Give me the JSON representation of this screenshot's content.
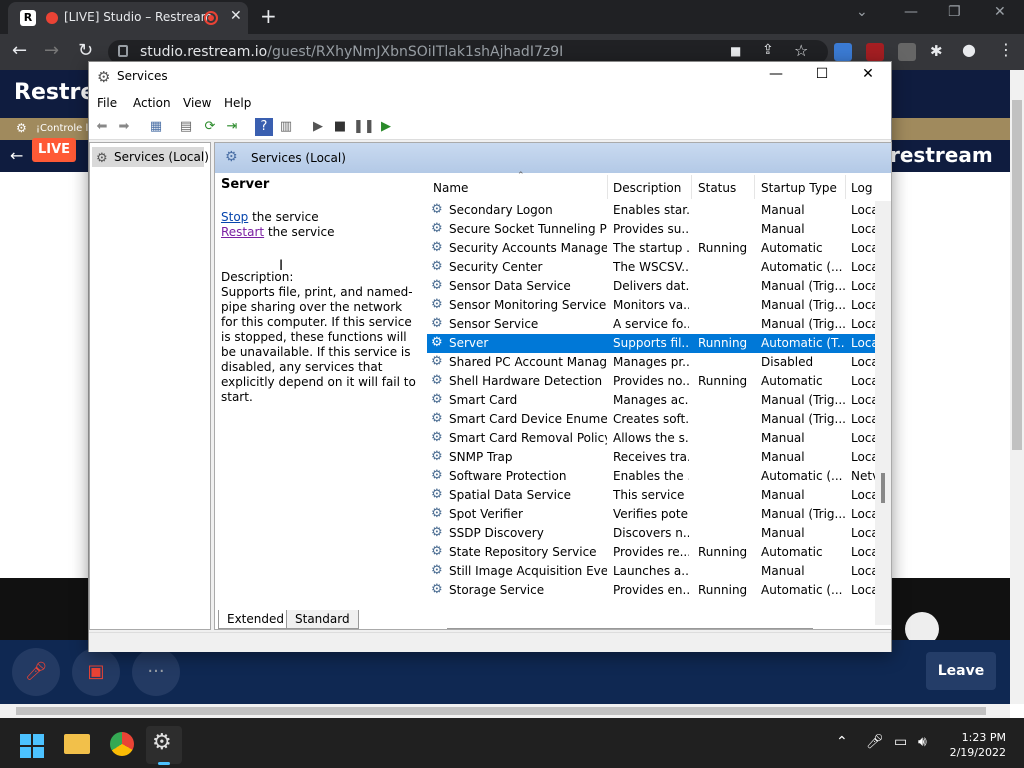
{
  "browser": {
    "tab_title": "[LIVE] Studio – Restream",
    "favicon_letter": "R",
    "url_host": "studio.restream.io",
    "url_path": "/guest/RXhyNmJXbnSOiITlak1shAjhadI7z9I",
    "new_tab": "+"
  },
  "page": {
    "logo": "Restrea",
    "live_badge": "LIVE",
    "banner": "¡Controle las",
    "logo_right": "restream",
    "leave_label": "Leave"
  },
  "services": {
    "title": "Services",
    "menu": [
      "File",
      "Action",
      "View",
      "Help"
    ],
    "tree_item": "Services (Local)",
    "pane_header": "Services (Local)",
    "selected": {
      "name": "Server",
      "stop_link": "Stop",
      "stop_rest": " the service",
      "restart_link": "Restart",
      "restart_rest": " the service",
      "desc_label": "Description:",
      "desc_text": "Supports file, print, and named-pipe sharing over the network for this computer. If this service is stopped, these functions will be unavailable. If this service is disabled, any services that explicitly depend on it will fail to start."
    },
    "columns": [
      "Name",
      "Description",
      "Status",
      "Startup Type",
      "Log"
    ],
    "rows": [
      [
        "Secondary Logon",
        "Enables star...",
        "",
        "Manual",
        "Loca"
      ],
      [
        "Secure Socket Tunneling Pr...",
        "Provides su...",
        "",
        "Manual",
        "Loca"
      ],
      [
        "Security Accounts Manager",
        "The startup ...",
        "Running",
        "Automatic",
        "Loca"
      ],
      [
        "Security Center",
        "The WSCSV...",
        "",
        "Automatic (...",
        "Loca"
      ],
      [
        "Sensor Data Service",
        "Delivers dat...",
        "",
        "Manual (Trig...",
        "Loca"
      ],
      [
        "Sensor Monitoring Service",
        "Monitors va...",
        "",
        "Manual (Trig...",
        "Loca"
      ],
      [
        "Sensor Service",
        "A service fo...",
        "",
        "Manual (Trig...",
        "Loca"
      ],
      [
        "Server",
        "Supports fil...",
        "Running",
        "Automatic (T...",
        "Loca"
      ],
      [
        "Shared PC Account Manager",
        "Manages pr...",
        "",
        "Disabled",
        "Loca"
      ],
      [
        "Shell Hardware Detection",
        "Provides no...",
        "Running",
        "Automatic",
        "Loca"
      ],
      [
        "Smart Card",
        "Manages ac...",
        "",
        "Manual (Trig...",
        "Loca"
      ],
      [
        "Smart Card Device Enumera...",
        "Creates soft...",
        "",
        "Manual (Trig...",
        "Loca"
      ],
      [
        "Smart Card Removal Policy",
        "Allows the s...",
        "",
        "Manual",
        "Loca"
      ],
      [
        "SNMP Trap",
        "Receives tra...",
        "",
        "Manual",
        "Loca"
      ],
      [
        "Software Protection",
        "Enables the ...",
        "",
        "Automatic (...",
        "Netv"
      ],
      [
        "Spatial Data Service",
        "This service ...",
        "",
        "Manual",
        "Loca"
      ],
      [
        "Spot Verifier",
        "Verifies pote...",
        "",
        "Manual (Trig...",
        "Loca"
      ],
      [
        "SSDP Discovery",
        "Discovers n...",
        "",
        "Manual",
        "Loca"
      ],
      [
        "State Repository Service",
        "Provides re...",
        "Running",
        "Automatic",
        "Loca"
      ],
      [
        "Still Image Acquisition Events",
        "Launches a...",
        "",
        "Manual",
        "Loca"
      ],
      [
        "Storage Service",
        "Provides en...",
        "Running",
        "Automatic (...",
        "Loca"
      ]
    ],
    "selected_row_index": 7,
    "tabs": [
      "Extended",
      "Standard"
    ]
  },
  "taskbar": {
    "time": "1:23 PM",
    "date": "2/19/2022"
  }
}
